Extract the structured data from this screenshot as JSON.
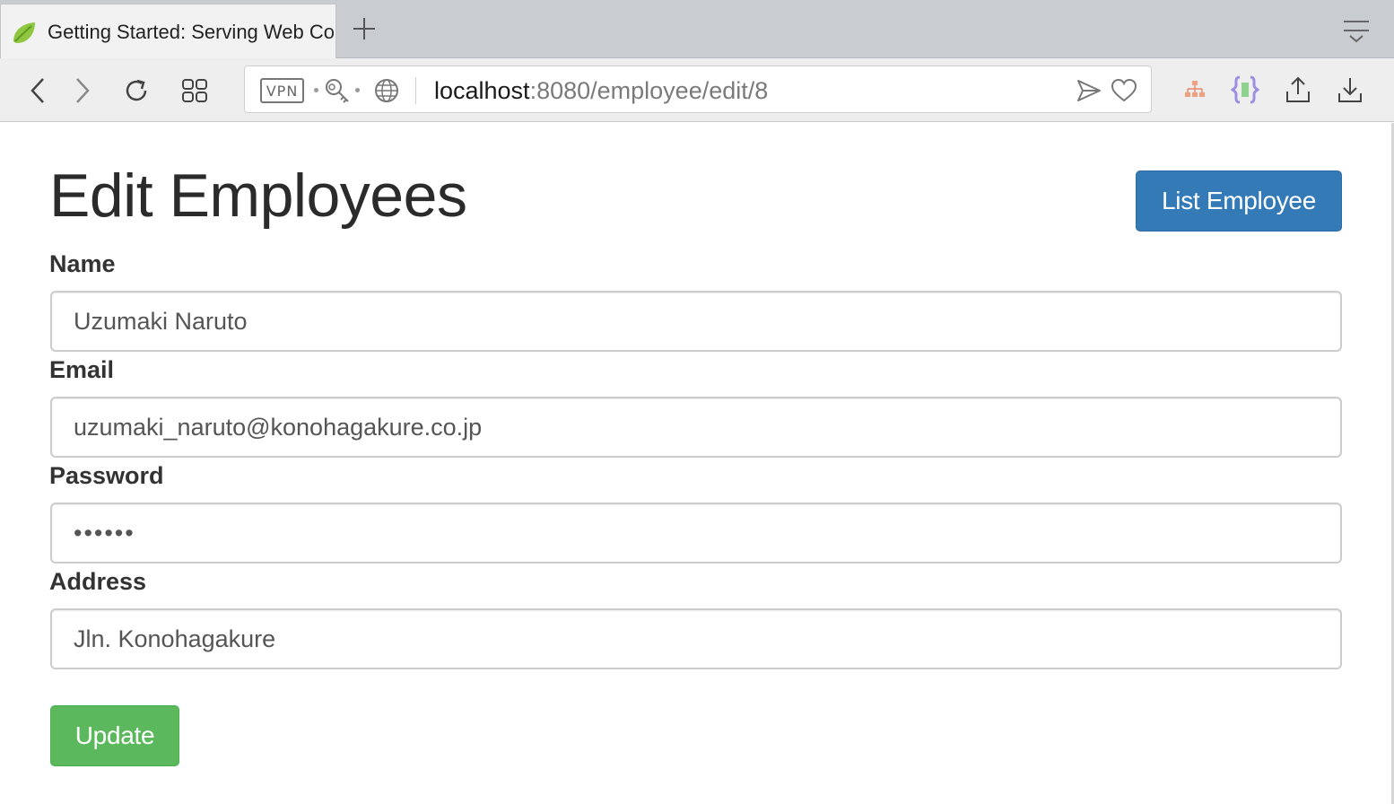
{
  "browser": {
    "tab": {
      "title": "Getting Started: Serving Web Content",
      "favicon": "spring-leaf-icon"
    },
    "url": {
      "host": "localhost",
      "rest": ":8080/employee/edit/8"
    },
    "vpn_label": "VPN",
    "icons": {
      "back": "chevron-left-icon",
      "forward": "chevron-right-icon",
      "reload": "reload-icon",
      "speed_dial": "grid-icon",
      "send": "send-icon",
      "bookmark": "heart-icon",
      "share": "share-icon",
      "download": "download-icon"
    }
  },
  "page": {
    "title": "Edit Employees",
    "list_button": "List Employee",
    "update_button": "Update",
    "fields": [
      {
        "label": "Name",
        "value": "Uzumaki Naruto"
      },
      {
        "label": "Email",
        "value": "uzumaki_naruto@konohagakure.co.jp"
      },
      {
        "label": "Password",
        "value": "••••••"
      },
      {
        "label": "Address",
        "value": "Jln. Konohagakure"
      }
    ]
  },
  "colors": {
    "primary": "#337ab7",
    "success": "#5cb85c",
    "text": "#333333"
  }
}
